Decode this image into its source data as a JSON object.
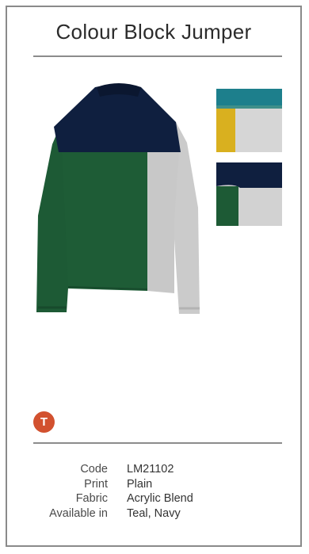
{
  "product": {
    "title": "Colour Block Jumper",
    "badge": "T",
    "specs": [
      {
        "label": "Code",
        "value": "LM21102"
      },
      {
        "label": "Print",
        "value": "Plain"
      },
      {
        "label": "Fabric",
        "value": "Acrylic Blend"
      },
      {
        "label": "Available in",
        "value": "Teal, Navy"
      }
    ]
  },
  "colors": {
    "navy": "#0f1f3f",
    "green": "#1d5a35",
    "grey": "#c9c9c9",
    "teal": "#1d7f8c",
    "mustard": "#d9b01f",
    "badge": "#d2512f"
  },
  "images": {
    "main_icon": "jumper-photo",
    "thumbnail_icons": [
      "fabric-swatch-teal-icon",
      "fabric-swatch-navy-icon"
    ]
  }
}
